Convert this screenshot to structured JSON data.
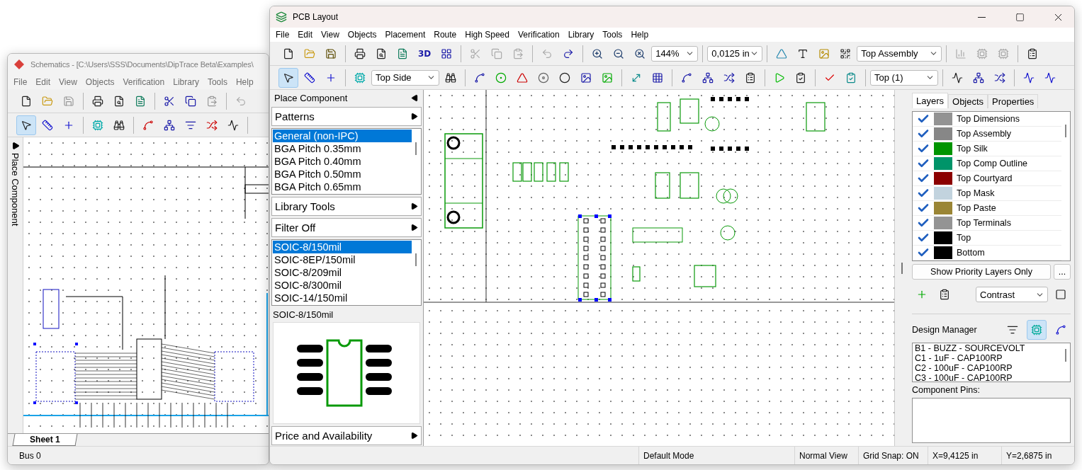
{
  "schematic_window": {
    "title": "Schematics - [C:\\Users\\SSS\\Documents\\DipTrace Beta\\Examples\\",
    "menu": [
      "File",
      "Edit",
      "View",
      "Objects",
      "Verification",
      "Library",
      "Tools",
      "Help"
    ],
    "placement_tools": [
      {
        "selected": true
      },
      {
        "selected": false
      },
      {
        "selected": false
      }
    ],
    "side_tab": "Place Component",
    "sheet_tabs": [
      {
        "label": "Sheet 1",
        "selected": true
      }
    ],
    "status_bar": [
      "Bus 0"
    ]
  },
  "pcb_window": {
    "title": "PCB Layout",
    "menu": [
      "File",
      "Edit",
      "View",
      "Objects",
      "Placement",
      "Route",
      "High Speed",
      "Verification",
      "Library",
      "Tools",
      "Help"
    ],
    "toolbar": {
      "view_3d": "3D",
      "zoom": "144%",
      "grid": "0,0125 in",
      "display_layer": "Top Assembly",
      "side": "Top Side",
      "route_layer": "Top (1)"
    },
    "placement_tools": [
      {
        "selected": true
      },
      {
        "selected": false
      },
      {
        "selected": false
      }
    ],
    "place_component": {
      "title": "Place Component",
      "patterns_menu": "Patterns",
      "libraries": [
        {
          "label": "General (non-IPC)",
          "selected": true
        },
        {
          "label": "BGA Pitch 0.35mm",
          "selected": false
        },
        {
          "label": "BGA Pitch 0.40mm",
          "selected": false
        },
        {
          "label": "BGA Pitch 0.50mm",
          "selected": false
        },
        {
          "label": "BGA Pitch 0.65mm",
          "selected": false
        }
      ],
      "library_tools": "Library Tools",
      "filter": "Filter Off",
      "patterns": [
        {
          "label": "SOIC-8/150mil",
          "selected": true
        },
        {
          "label": "SOIC-8EP/150mil",
          "selected": false
        },
        {
          "label": "SOIC-8/209mil",
          "selected": false
        },
        {
          "label": "SOIC-8/300mil",
          "selected": false
        },
        {
          "label": "SOIC-14/150mil",
          "selected": false
        }
      ],
      "preview_title": "SOIC-8/150mil",
      "price": "Price and Availability"
    },
    "right_panel": {
      "tabs": [
        {
          "label": "Layers",
          "selected": true
        },
        {
          "label": "Objects",
          "selected": false
        },
        {
          "label": "Properties",
          "selected": false
        }
      ],
      "layers": [
        {
          "name": "Top Dimensions",
          "visible": true,
          "color": "#939393"
        },
        {
          "name": "Top Assembly",
          "visible": true,
          "color": "#878787"
        },
        {
          "name": "Top Silk",
          "visible": true,
          "color": "#009400"
        },
        {
          "name": "Top Comp Outline",
          "visible": true,
          "color": "#009469"
        },
        {
          "name": "Top Courtyard",
          "visible": true,
          "color": "#8b0000"
        },
        {
          "name": "Top Mask",
          "visible": true,
          "color": "#c2d3de"
        },
        {
          "name": "Top Paste",
          "visible": true,
          "color": "#9a8535"
        },
        {
          "name": "Top Terminals",
          "visible": true,
          "color": "#949494"
        },
        {
          "name": "Top",
          "visible": true,
          "color": "#000000"
        },
        {
          "name": "Bottom",
          "visible": true,
          "color": "#000000"
        }
      ],
      "priority_button": "Show Priority Layers Only",
      "more_button": "...",
      "contrast": "Contrast",
      "design_manager": {
        "title": "Design Manager",
        "components": [
          "B1 - BUZZ - SOURCEVOLT",
          "C1 - 1uF - CAP100RP",
          "C2 - 100uF - CAP100RP",
          "C3 - 100uF - CAP100RP"
        ]
      },
      "pins_label": "Component Pins:"
    },
    "status_bar": [
      "Default Mode",
      "Normal View",
      "Grid Snap: ON",
      "X=9,4125 in",
      "Y=2,6875 in"
    ]
  }
}
